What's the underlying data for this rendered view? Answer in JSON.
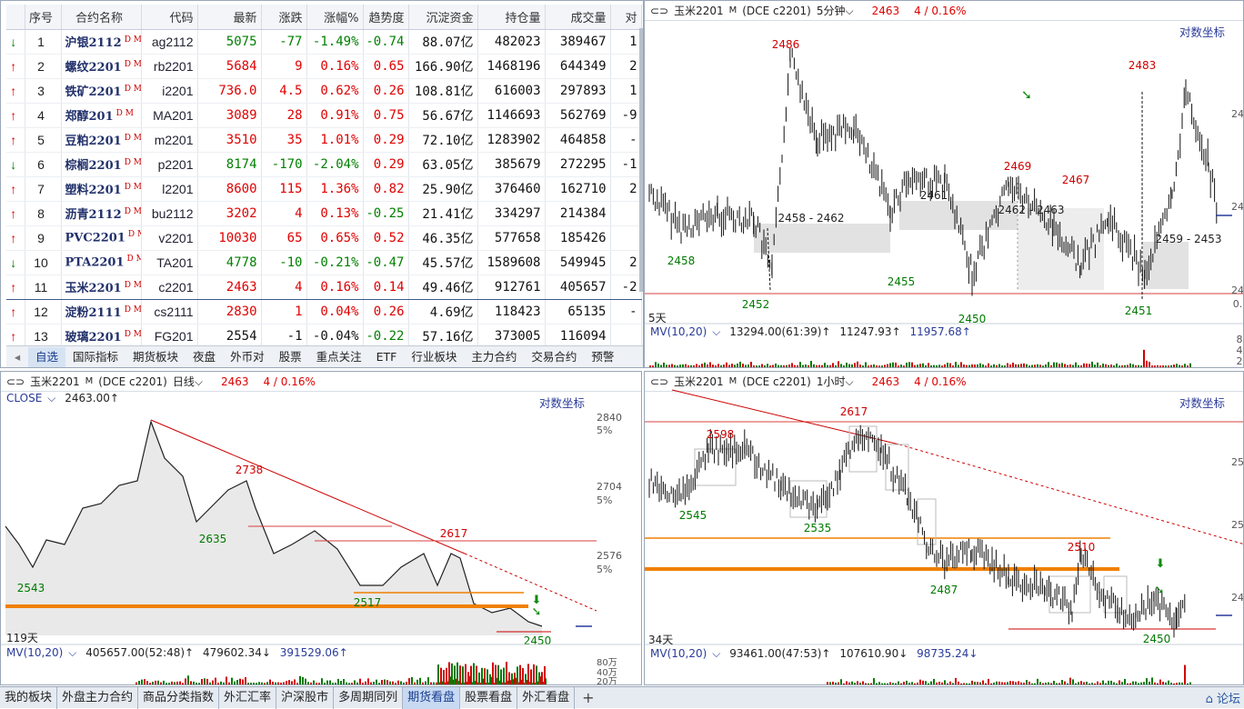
{
  "quote": {
    "headers": [
      "序号",
      "合约名称",
      "代码",
      "最新",
      "涨跌",
      "涨幅%",
      "趋势度",
      "沉淀资金",
      "持仓量",
      "成交量",
      "对"
    ],
    "rows": [
      {
        "dir": "down",
        "no": "1",
        "name": "沪银2112",
        "code": "ag2112",
        "last": "5075",
        "chg": "-77",
        "pct": "-1.49%",
        "trend": "-0.74",
        "fund": "88.07亿",
        "oi": "482023",
        "vol": "389467",
        "extra": "1",
        "c": "dn",
        "tc": "dn"
      },
      {
        "dir": "up",
        "no": "2",
        "name": "螺纹2201",
        "code": "rb2201",
        "last": "5684",
        "chg": "9",
        "pct": "0.16%",
        "trend": "0.65",
        "fund": "166.90亿",
        "oi": "1468196",
        "vol": "644349",
        "extra": "2",
        "c": "up",
        "tc": "up"
      },
      {
        "dir": "up",
        "no": "3",
        "name": "铁矿2201",
        "code": "i2201",
        "last": "736.0",
        "chg": "4.5",
        "pct": "0.62%",
        "trend": "0.26",
        "fund": "108.81亿",
        "oi": "616003",
        "vol": "297893",
        "extra": "1",
        "c": "up",
        "tc": "up"
      },
      {
        "dir": "up",
        "no": "4",
        "name": "郑醇201",
        "code": "MA201",
        "last": "3089",
        "chg": "28",
        "pct": "0.91%",
        "trend": "0.75",
        "fund": "56.67亿",
        "oi": "1146693",
        "vol": "562769",
        "extra": "-9",
        "c": "up",
        "tc": "up"
      },
      {
        "dir": "up",
        "no": "5",
        "name": "豆粕2201",
        "code": "m2201",
        "last": "3510",
        "chg": "35",
        "pct": "1.01%",
        "trend": "0.29",
        "fund": "72.10亿",
        "oi": "1283902",
        "vol": "464858",
        "extra": "-",
        "c": "up",
        "tc": "up"
      },
      {
        "dir": "down",
        "no": "6",
        "name": "棕榈2201",
        "code": "p2201",
        "last": "8174",
        "chg": "-170",
        "pct": "-2.04%",
        "trend": "0.29",
        "fund": "63.05亿",
        "oi": "385679",
        "vol": "272295",
        "extra": "-1",
        "c": "dn",
        "tc": "up"
      },
      {
        "dir": "up",
        "no": "7",
        "name": "塑料2201",
        "code": "l2201",
        "last": "8600",
        "chg": "115",
        "pct": "1.36%",
        "trend": "0.82",
        "fund": "25.90亿",
        "oi": "376460",
        "vol": "162710",
        "extra": "2",
        "c": "up",
        "tc": "up"
      },
      {
        "dir": "up",
        "no": "8",
        "name": "沥青2112",
        "code": "bu2112",
        "last": "3202",
        "chg": "4",
        "pct": "0.13%",
        "trend": "-0.25",
        "fund": "21.41亿",
        "oi": "334297",
        "vol": "214384",
        "extra": "",
        "c": "up",
        "tc": "dn"
      },
      {
        "dir": "up",
        "no": "9",
        "name": "PVC2201",
        "code": "v2201",
        "last": "10030",
        "chg": "65",
        "pct": "0.65%",
        "trend": "0.52",
        "fund": "46.35亿",
        "oi": "577658",
        "vol": "185426",
        "extra": "",
        "c": "up",
        "tc": "up"
      },
      {
        "dir": "down",
        "no": "10",
        "name": "PTA2201",
        "code": "TA201",
        "last": "4778",
        "chg": "-10",
        "pct": "-0.21%",
        "trend": "-0.47",
        "fund": "45.57亿",
        "oi": "1589608",
        "vol": "549945",
        "extra": "2",
        "c": "dn",
        "tc": "dn"
      },
      {
        "dir": "up",
        "no": "11",
        "name": "玉米2201",
        "code": "c2201",
        "last": "2463",
        "chg": "4",
        "pct": "0.16%",
        "trend": "0.14",
        "fund": "49.46亿",
        "oi": "912761",
        "vol": "405657",
        "extra": "-2",
        "c": "up",
        "tc": "up"
      },
      {
        "dir": "up",
        "no": "12",
        "name": "淀粉2111",
        "code": "cs2111",
        "last": "2830",
        "chg": "1",
        "pct": "0.04%",
        "trend": "0.26",
        "fund": "4.69亿",
        "oi": "118423",
        "vol": "65135",
        "extra": "-",
        "c": "up",
        "tc": "up"
      },
      {
        "dir": "up",
        "no": "13",
        "name": "玻璃2201",
        "code": "FG201",
        "last": "2554",
        "chg": "-1",
        "pct": "-0.04%",
        "trend": "-0.22",
        "fund": "57.16亿",
        "oi": "373005",
        "vol": "116094",
        "extra": "",
        "c": "bk",
        "tc": "dn"
      }
    ],
    "dm": "D M",
    "tabs": [
      "自选",
      "国际指标",
      "期货板块",
      "夜盘",
      "外币对",
      "股票",
      "重点关注",
      "ETF",
      "行业板块",
      "主力合约",
      "交易合约",
      "预警"
    ]
  },
  "charts": {
    "log_coord": "对数坐标",
    "tr": {
      "symbol": "玉米2201",
      "sup": "M",
      "exch": "(DCE c2201)",
      "period": "5分钟",
      "price": "2463",
      "change": "4 / 0.16%",
      "mv_label": "MV(10,20)",
      "mv1": "13294.00(61:39)↑",
      "mv2": "11247.93↑",
      "mv3": "11957.68↑",
      "days": "5天",
      "marks": [
        {
          "t": "2486",
          "c": "up"
        },
        {
          "t": "2458",
          "c": "dn"
        },
        {
          "t": "2452",
          "c": "dn"
        },
        {
          "t": "2458 - 2462",
          "c": "bk"
        },
        {
          "t": "2455",
          "c": "dn"
        },
        {
          "t": "2461",
          "c": "bk"
        },
        {
          "t": "2469",
          "c": "up"
        },
        {
          "t": "2450",
          "c": "dn"
        },
        {
          "t": "2462 - 2463",
          "c": "bk"
        },
        {
          "t": "2467",
          "c": "up"
        },
        {
          "t": "2483",
          "c": "up"
        },
        {
          "t": "2459 - 2453",
          "c": "bk"
        },
        {
          "t": "2451",
          "c": "dn"
        }
      ],
      "axis": [
        "24",
        "24",
        "24",
        "0."
      ],
      "vol_axis": [
        "8",
        "4",
        "2"
      ]
    },
    "bl": {
      "symbol": "玉米2201",
      "sup": "M",
      "exch": "(DCE c2201)",
      "period": "日线",
      "price": "2463",
      "change": "4 / 0.16%",
      "close_label": "CLOSE",
      "close_val": "2463.00↑",
      "mv_label": "MV(10,20)",
      "mv1": "405657.00(52:48)↑",
      "mv2": "479602.34↓",
      "mv3": "391529.06↑",
      "days": "119天",
      "marks": [
        {
          "t": "2738",
          "c": "up"
        },
        {
          "t": "2635",
          "c": "dn"
        },
        {
          "t": "2543",
          "c": "dn"
        },
        {
          "t": "2617",
          "c": "up"
        },
        {
          "t": "2517",
          "c": "dn"
        },
        {
          "t": "2450",
          "c": "dn"
        }
      ],
      "axis": [
        {
          "v": "2840",
          "p": "5%"
        },
        {
          "v": "2704",
          "p": "5%"
        },
        {
          "v": "2576",
          "p": "5%"
        }
      ],
      "vol_axis": [
        "80万",
        "40万",
        "20万"
      ]
    },
    "br": {
      "symbol": "玉米2201",
      "sup": "M",
      "exch": "(DCE c2201)",
      "period": "1小时",
      "price": "2463",
      "change": "4 / 0.16%",
      "mv_label": "MV(10,20)",
      "mv1": "93461.00(47:53)↑",
      "mv2": "107610.90↓",
      "mv3": "98735.24↓",
      "days": "34天",
      "marks": [
        {
          "t": "2617",
          "c": "up"
        },
        {
          "t": "2598",
          "c": "up"
        },
        {
          "t": "2545",
          "c": "dn"
        },
        {
          "t": "2535",
          "c": "dn"
        },
        {
          "t": "2510",
          "c": "up"
        },
        {
          "t": "2487",
          "c": "dn"
        },
        {
          "t": "2450",
          "c": "dn"
        }
      ],
      "axis": [
        "25",
        "25",
        "24"
      ]
    }
  },
  "bottom_tabs": [
    "我的板块",
    "外盘主力合约",
    "商品分类指数",
    "外汇汇率",
    "沪深股市",
    "多周期同列",
    "期货看盘",
    "股票看盘",
    "外汇看盘"
  ],
  "bottom_active": "期货看盘",
  "bottom_right": "论坛"
}
